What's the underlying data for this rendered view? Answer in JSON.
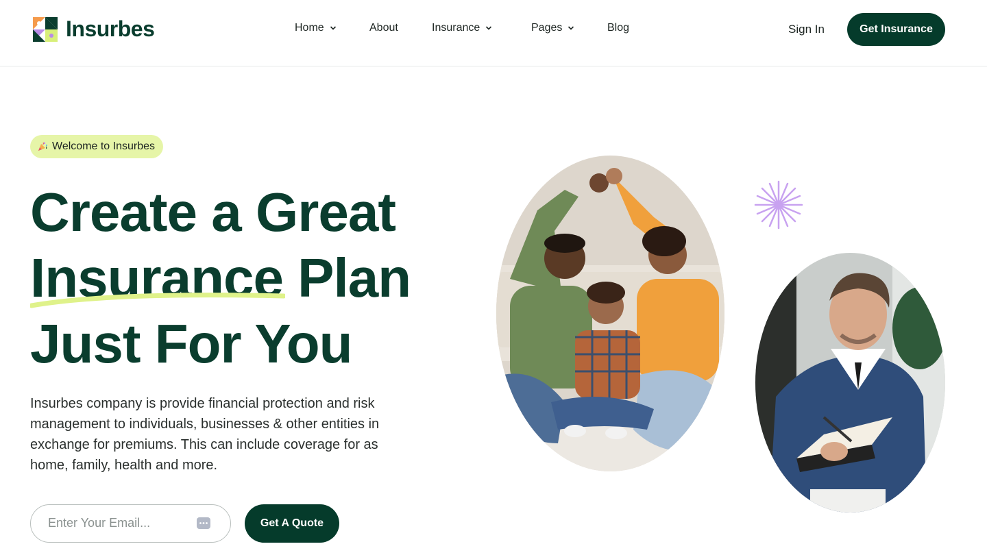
{
  "brand": {
    "name": "Insurbes"
  },
  "nav": {
    "items": [
      {
        "label": "Home",
        "has_dropdown": true
      },
      {
        "label": "About",
        "has_dropdown": false
      },
      {
        "label": "Insurance",
        "has_dropdown": true
      },
      {
        "label": "Pages",
        "has_dropdown": true
      },
      {
        "label": "Blog",
        "has_dropdown": false
      }
    ],
    "sign_in": "Sign In",
    "cta": "Get Insurance"
  },
  "hero": {
    "badge": "Welcome to Insurbes",
    "headline_line1": "Create a Great",
    "headline_word_highlight": "Insurance",
    "headline_line2_rest": " Plan",
    "headline_line3": "Just For You",
    "description": "Insurbes company is provide financial protection and risk management to individuals, businesses & other entities in exchange for premiums. This can include coverage for as home, family, health and more.",
    "email_placeholder": "Enter Your Email...",
    "email_value": "",
    "quote_button": "Get A Quote"
  },
  "icons": {
    "badge": "party-popper-icon",
    "email": "chat-dots-icon",
    "dropdown": "chevron-down-icon",
    "decor": "sparkle-burst-icon"
  },
  "colors": {
    "primary": "#053b2b",
    "heading": "#0a3d2e",
    "badge_bg": "#e6f5a8",
    "highlight_underline": "#dff28a",
    "sparkle": "#c8a2f0",
    "logo_orange": "#f59b4c",
    "logo_purple": "#b88be8",
    "logo_lime": "#d8ef7a",
    "logo_green": "#0a3d2e"
  }
}
